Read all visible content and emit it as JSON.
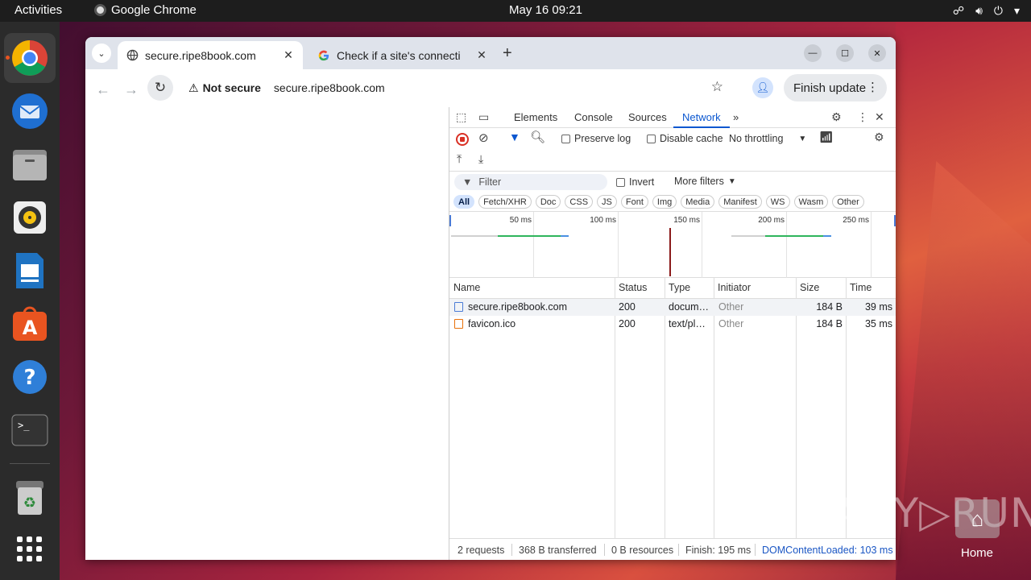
{
  "topbar": {
    "activities": "Activities",
    "app_name": "Google Chrome",
    "clock": "May 16  09:21"
  },
  "dock": {
    "items": [
      "chrome",
      "thunderbird",
      "files",
      "rhythmbox",
      "libreoffice-writer",
      "app-center",
      "help",
      "terminal",
      "trash",
      "show-apps"
    ]
  },
  "browser": {
    "tabs": [
      {
        "title": "secure.ripe8book.com",
        "active": true
      },
      {
        "title": "Check if a site's connecti",
        "active": false
      }
    ],
    "security_label": "Not secure",
    "url": "secure.ripe8book.com",
    "finish_update": "Finish update"
  },
  "devtools": {
    "tabs": [
      "Elements",
      "Console",
      "Sources",
      "Network"
    ],
    "active_tab": "Network",
    "more_tabs": "»",
    "preserve_log": "Preserve log",
    "disable_cache": "Disable cache",
    "throttling": "No throttling",
    "filter_placeholder": "Filter",
    "invert": "Invert",
    "more_filters": "More filters",
    "type_filters": [
      "All",
      "Fetch/XHR",
      "Doc",
      "CSS",
      "JS",
      "Font",
      "Img",
      "Media",
      "Manifest",
      "WS",
      "Wasm",
      "Other"
    ],
    "timeline_ticks": [
      "50 ms",
      "100 ms",
      "150 ms",
      "200 ms",
      "250 ms"
    ],
    "columns": [
      "Name",
      "Status",
      "Type",
      "Initiator",
      "Size",
      "Time"
    ],
    "requests": [
      {
        "name": "secure.ripe8book.com",
        "status": "200",
        "type": "docum…",
        "initiator": "Other",
        "size": "184 B",
        "time": "39 ms"
      },
      {
        "name": "favicon.ico",
        "status": "200",
        "type": "text/pl…",
        "initiator": "Other",
        "size": "184 B",
        "time": "35 ms"
      }
    ],
    "summary": {
      "requests": "2 requests",
      "transferred": "368 B transferred",
      "resources": "0 B resources",
      "finish": "Finish: 195 ms",
      "dom_loaded": "DOMContentLoaded: 103 ms"
    }
  },
  "desktop": {
    "home_label": "Home",
    "watermark": "ANY▷RUN"
  },
  "colors": {
    "accent": "#0b57d0",
    "ubuntu_orange": "#e95420",
    "record_red": "#d93025"
  }
}
